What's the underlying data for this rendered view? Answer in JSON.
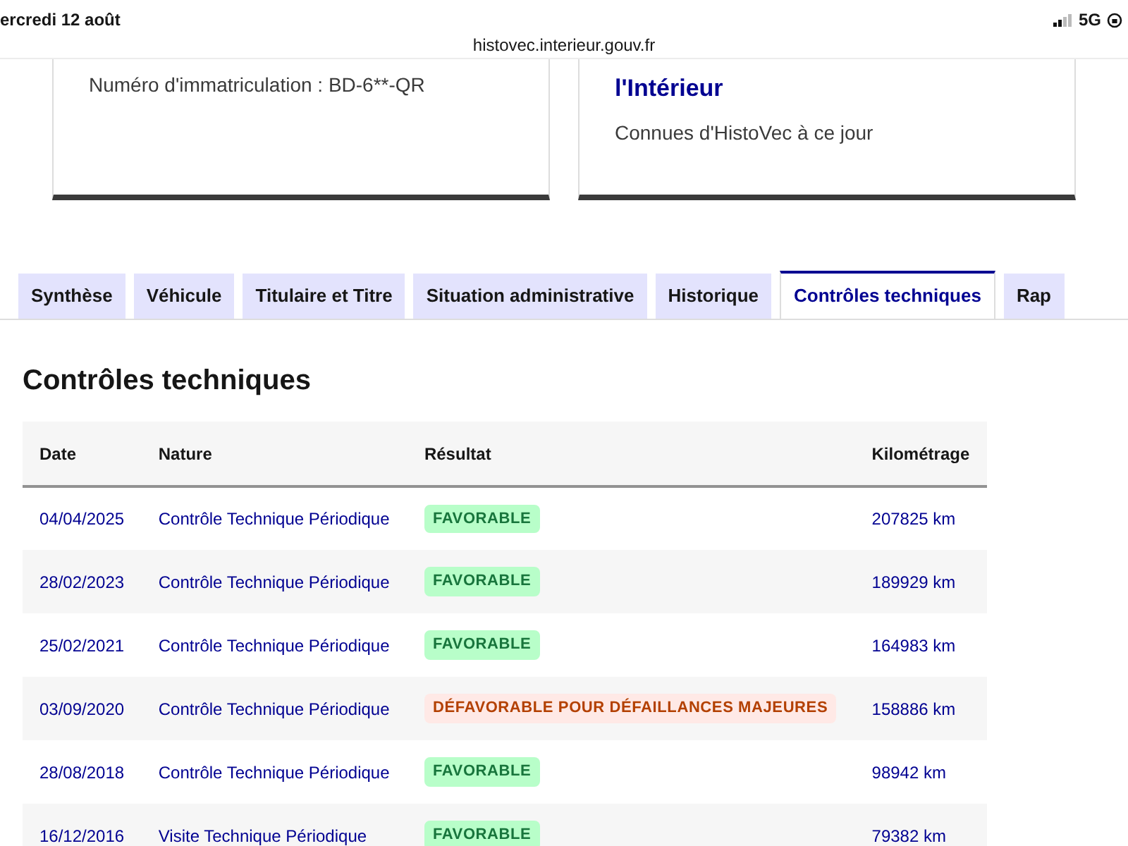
{
  "status_bar": {
    "date": "ercredi 12 août",
    "url": "histovec.interieur.gouv.fr",
    "network": "5G"
  },
  "cards": [
    {
      "text": "Numéro d'immatriculation : BD-6**-QR"
    },
    {
      "title": "l'Intérieur",
      "text": "Connues d'HistoVec à ce jour"
    }
  ],
  "tabs": [
    {
      "label": "Synthèse",
      "selected": false
    },
    {
      "label": "Véhicule",
      "selected": false
    },
    {
      "label": "Titulaire et Titre",
      "selected": false
    },
    {
      "label": "Situation administrative",
      "selected": false
    },
    {
      "label": "Historique",
      "selected": false
    },
    {
      "label": "Contrôles techniques",
      "selected": true
    },
    {
      "label": "Rap",
      "selected": false
    }
  ],
  "section_title": "Contrôles techniques",
  "table": {
    "columns": [
      "Date",
      "Nature",
      "Résultat",
      "Kilométrage"
    ],
    "rows": [
      {
        "date": "04/04/2025",
        "nature": "Contrôle Technique Périodique",
        "result": "FAVORABLE",
        "kind": "success",
        "km": "207825 km"
      },
      {
        "date": "28/02/2023",
        "nature": "Contrôle Technique Périodique",
        "result": "FAVORABLE",
        "kind": "success",
        "km": "189929 km"
      },
      {
        "date": "25/02/2021",
        "nature": "Contrôle Technique Périodique",
        "result": "FAVORABLE",
        "kind": "success",
        "km": "164983 km"
      },
      {
        "date": "03/09/2020",
        "nature": "Contrôle Technique Périodique",
        "result": "DÉFAVORABLE POUR DÉFAILLANCES MAJEURES",
        "kind": "error",
        "km": "158886 km"
      },
      {
        "date": "28/08/2018",
        "nature": "Contrôle Technique Périodique",
        "result": "FAVORABLE",
        "kind": "success",
        "km": "98942 km"
      },
      {
        "date": "16/12/2016",
        "nature": "Visite Technique Périodique",
        "result": "FAVORABLE",
        "kind": "success",
        "km": "79382 km"
      }
    ]
  }
}
